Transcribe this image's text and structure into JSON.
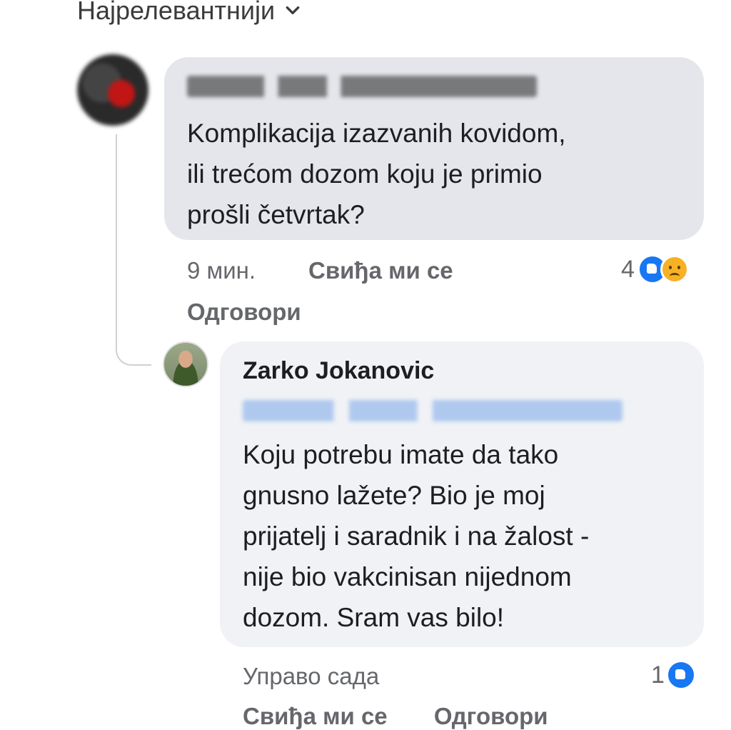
{
  "sort": {
    "label": "Најрелевантнији"
  },
  "comment": {
    "lines": [
      "Komplikacija izazvanih kovidom,",
      "ili trećom dozom koju je primio",
      "prošli četvrtak?"
    ],
    "time": "9 мин.",
    "like_label": "Свиђа ми се",
    "reply_label": "Одговори",
    "reaction_count": "4",
    "reactions": [
      "like-icon",
      "sad-icon"
    ]
  },
  "reply": {
    "author": "Zarko Jokanovic",
    "lines": [
      "Koju potrebu imate da tako",
      "gnusno lažete? Bio je moj",
      "prijatelj i saradnik i na žalost -",
      "nije bio vakcinisan nijednom",
      "dozom. Sram vas bilo!"
    ],
    "time": "Управо сада",
    "reaction_count": "1",
    "reactions": [
      "like-icon"
    ],
    "like_label": "Свиђа ми се",
    "reply_label": "Одговори"
  },
  "colors": {
    "bubble": "#e4e6eb",
    "reply_bubble": "#f0f2f5",
    "meta": "#65676b",
    "like": "#1877f2"
  }
}
